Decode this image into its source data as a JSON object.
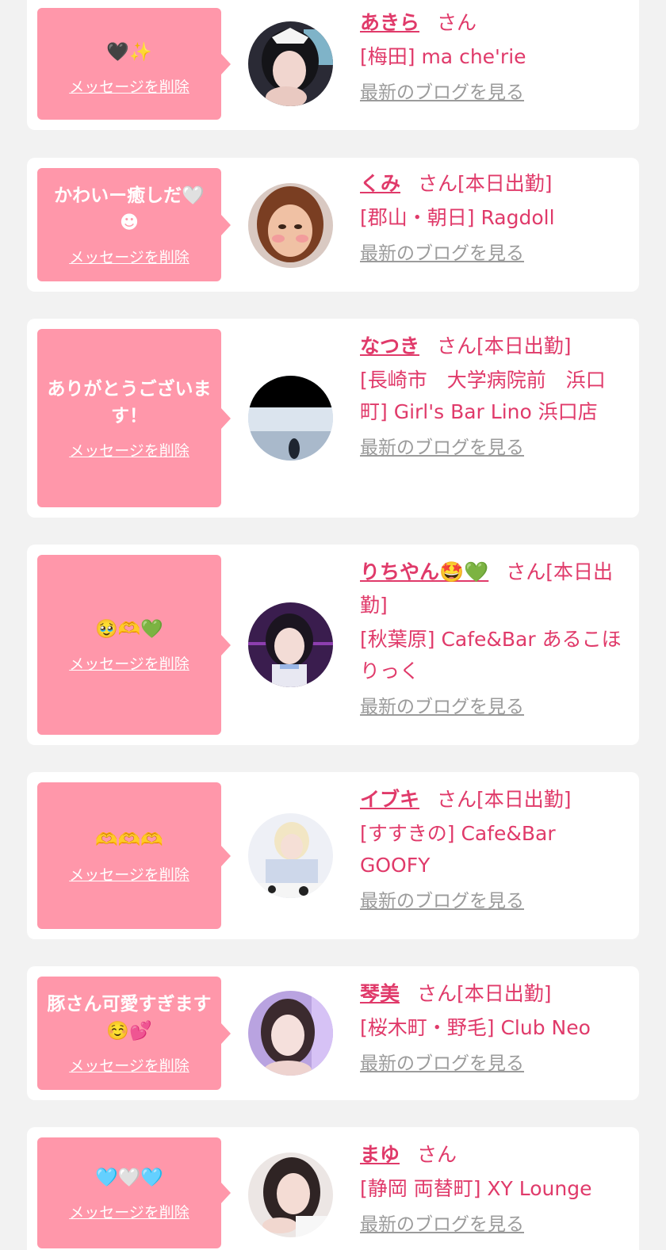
{
  "delete_label": "メッセージを削除",
  "san_label": "さん",
  "blog_label": "最新のブログを見る",
  "colors": {
    "background": "#f2f2f2",
    "card": "#ffffff",
    "bubble": "#ff97aa",
    "accent": "#e03a6a",
    "link_gray": "#9b9b9b"
  },
  "items": [
    {
      "message": "🖤✨",
      "name": "あきら",
      "status": "",
      "shop": "[梅田] ma che'rie"
    },
    {
      "message": "かわいー癒しだ🤍☻",
      "name": "くみ",
      "status": "[本日出勤]",
      "shop": "[郡山・朝日] Ragdoll"
    },
    {
      "message": "ありがとうございます！",
      "name": "なつき",
      "status": "[本日出勤]",
      "shop": "[長崎市　大学病院前　浜口町] Girl's Bar Lino 浜口店"
    },
    {
      "message": "🥹🫶💚",
      "name": "りちやん🤩💚",
      "status": "[本日出勤]",
      "shop": "[秋葉原] Cafe&Bar あるこほりっく"
    },
    {
      "message": "🫶🫶🫶",
      "name": "イブキ",
      "status": "[本日出勤]",
      "shop": "[すすきの] Cafe&Bar GOOFY"
    },
    {
      "message": "豚さん可愛すぎます☺️💕",
      "name": "琴美",
      "status": "[本日出勤]",
      "shop": "[桜木町・野毛] Club Neo"
    },
    {
      "message": "🩵🤍🩵",
      "name": "まゆ",
      "status": "",
      "shop": "[静岡 両替町] XY Lounge"
    }
  ]
}
